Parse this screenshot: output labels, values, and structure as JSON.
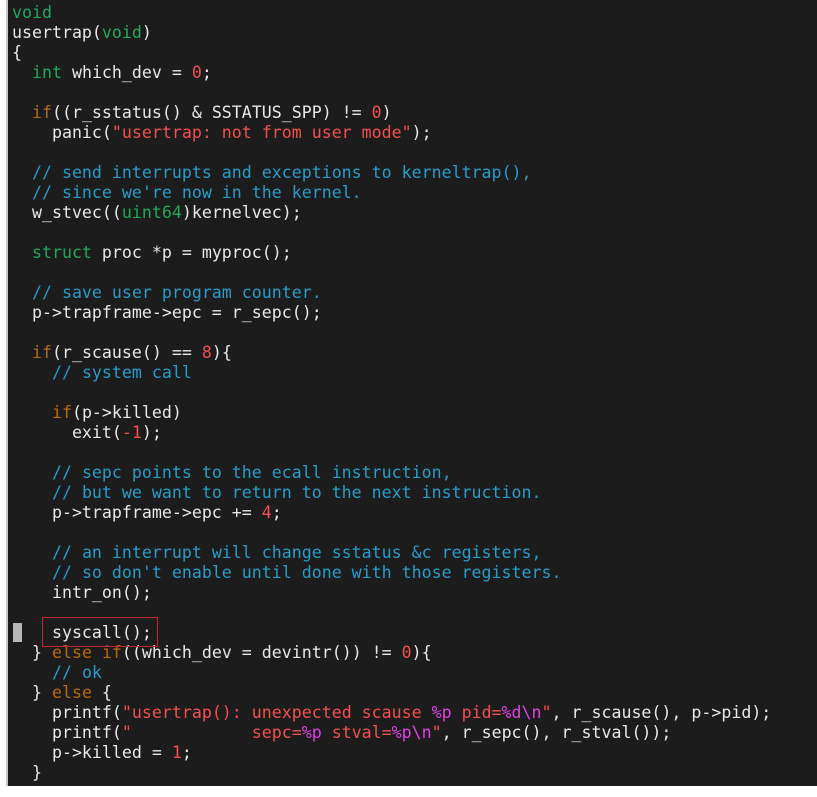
{
  "editor": {
    "colors": {
      "background": "#1c1c1c",
      "text": "#e8e8e8",
      "type": "#22a859",
      "control": "#b8690f",
      "string": "#f2504f",
      "number": "#f2504f",
      "comment": "#2a9cc8",
      "format": "#e040e6",
      "highlight_box": "#c0262c"
    },
    "lines": [
      [
        [
          "k",
          "void"
        ]
      ],
      [
        [
          "n",
          "usertrap("
        ],
        [
          "k",
          "void"
        ],
        [
          "n",
          ")"
        ]
      ],
      [
        [
          "n",
          "{"
        ]
      ],
      [
        [
          "n",
          "  "
        ],
        [
          "k",
          "int"
        ],
        [
          "n",
          " which_dev = "
        ],
        [
          "m",
          "0"
        ],
        [
          "n",
          ";"
        ]
      ],
      [],
      [
        [
          "n",
          "  "
        ],
        [
          "c",
          "if"
        ],
        [
          "n",
          "((r_sstatus() & SSTATUS_SPP) != "
        ],
        [
          "m",
          "0"
        ],
        [
          "n",
          ")"
        ]
      ],
      [
        [
          "n",
          "    panic("
        ],
        [
          "s",
          "\"usertrap: not from user mode\""
        ],
        [
          "n",
          ");"
        ]
      ],
      [],
      [
        [
          "n",
          "  "
        ],
        [
          "cm",
          "// send interrupts and exceptions to kerneltrap(),"
        ]
      ],
      [
        [
          "n",
          "  "
        ],
        [
          "cm",
          "// since we're now in the kernel."
        ]
      ],
      [
        [
          "n",
          "  w_stvec(("
        ],
        [
          "k",
          "uint64"
        ],
        [
          "n",
          ")kernelvec);"
        ]
      ],
      [],
      [
        [
          "n",
          "  "
        ],
        [
          "k",
          "struct"
        ],
        [
          "n",
          " proc *p = myproc();"
        ]
      ],
      [],
      [
        [
          "n",
          "  "
        ],
        [
          "cm",
          "// save user program counter."
        ]
      ],
      [
        [
          "n",
          "  p->trapframe->epc = r_sepc();"
        ]
      ],
      [],
      [
        [
          "n",
          "  "
        ],
        [
          "c",
          "if"
        ],
        [
          "n",
          "(r_scause() == "
        ],
        [
          "m",
          "8"
        ],
        [
          "n",
          "){"
        ]
      ],
      [
        [
          "n",
          "    "
        ],
        [
          "cm",
          "// system call"
        ]
      ],
      [],
      [
        [
          "n",
          "    "
        ],
        [
          "c",
          "if"
        ],
        [
          "n",
          "(p->killed)"
        ]
      ],
      [
        [
          "n",
          "      exit("
        ],
        [
          "m",
          "-1"
        ],
        [
          "n",
          ");"
        ]
      ],
      [],
      [
        [
          "n",
          "    "
        ],
        [
          "cm",
          "// sepc points to the ecall instruction,"
        ]
      ],
      [
        [
          "n",
          "    "
        ],
        [
          "cm",
          "// but we want to return to the next instruction."
        ]
      ],
      [
        [
          "n",
          "    p->trapframe->epc += "
        ],
        [
          "m",
          "4"
        ],
        [
          "n",
          ";"
        ]
      ],
      [],
      [
        [
          "n",
          "    "
        ],
        [
          "cm",
          "// an interrupt will change sstatus &c registers,"
        ]
      ],
      [
        [
          "n",
          "    "
        ],
        [
          "cm",
          "// so don't enable until done with those registers."
        ]
      ],
      [
        [
          "n",
          "    intr_on();"
        ]
      ],
      [],
      [
        [
          "n",
          "    syscall();"
        ]
      ],
      [
        [
          "n",
          "  } "
        ],
        [
          "c",
          "else"
        ],
        [
          "n",
          " "
        ],
        [
          "c",
          "if"
        ],
        [
          "n",
          "((which_dev = devintr()) != "
        ],
        [
          "m",
          "0"
        ],
        [
          "n",
          "){"
        ]
      ],
      [
        [
          "n",
          "    "
        ],
        [
          "cm",
          "// ok"
        ]
      ],
      [
        [
          "n",
          "  } "
        ],
        [
          "c",
          "else"
        ],
        [
          "n",
          " {"
        ]
      ],
      [
        [
          "n",
          "    printf("
        ],
        [
          "s",
          "\"usertrap(): unexpected scause "
        ],
        [
          "f",
          "%p"
        ],
        [
          "s",
          " pid="
        ],
        [
          "f",
          "%d\\n"
        ],
        [
          "s",
          "\""
        ],
        [
          "n",
          ", r_scause(), p->pid);"
        ]
      ],
      [
        [
          "n",
          "    printf("
        ],
        [
          "s",
          "\"            sepc="
        ],
        [
          "f",
          "%p"
        ],
        [
          "s",
          " stval="
        ],
        [
          "f",
          "%p\\n"
        ],
        [
          "s",
          "\""
        ],
        [
          "n",
          ", r_sepc(), r_stval());"
        ]
      ],
      [
        [
          "n",
          "    p->killed = "
        ],
        [
          "m",
          "1"
        ],
        [
          "n",
          ";"
        ]
      ],
      [
        [
          "n",
          "  }"
        ]
      ]
    ]
  }
}
